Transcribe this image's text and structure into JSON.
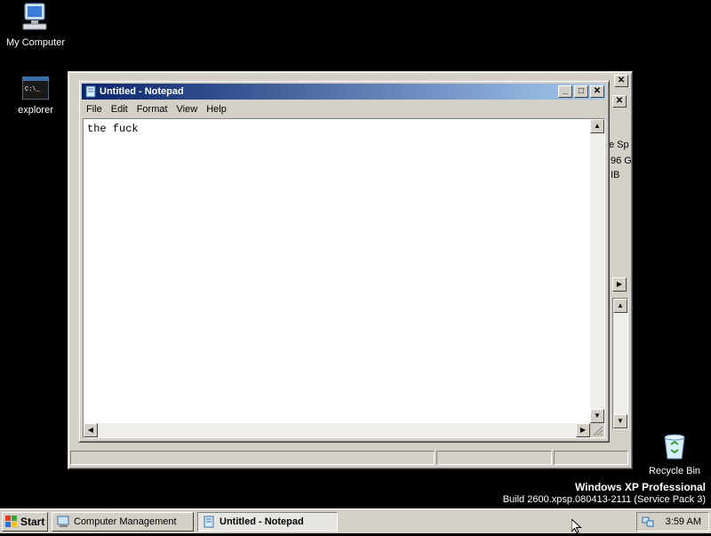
{
  "desktop": {
    "icons": [
      {
        "label": "My Computer"
      },
      {
        "label": "explorer"
      },
      {
        "label": "Recycle Bin"
      }
    ],
    "watermark": {
      "edition": "Windows XP Professional",
      "build": "Build 2600.xpsp.080413-2111 (Service Pack 3)"
    }
  },
  "background_window": {
    "partial_texts": [
      "e Sp",
      "96 G",
      "IB"
    ],
    "close_label": "✕"
  },
  "notepad": {
    "title": "Untitled - Notepad",
    "menu": [
      "File",
      "Edit",
      "Format",
      "View",
      "Help"
    ],
    "content": "the fuck",
    "buttons": {
      "minimize": "_",
      "maximize": "□",
      "close": "✕"
    }
  },
  "taskbar": {
    "start_label": "Start",
    "tasks": [
      {
        "label": "Computer Management",
        "active": false
      },
      {
        "label": "Untitled - Notepad",
        "active": true
      }
    ],
    "clock": "3:59 AM"
  },
  "colors": {
    "desktop": "#000000",
    "titlebar_start": "#0a246a",
    "titlebar_end": "#a6caf0",
    "chrome": "#d4d0c8"
  }
}
